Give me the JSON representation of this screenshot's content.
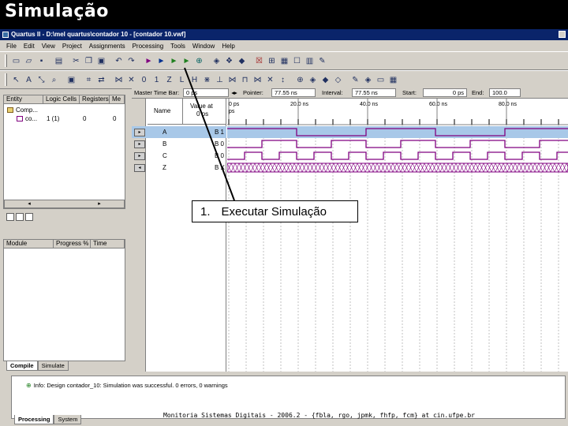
{
  "slide": {
    "title": "Simulação"
  },
  "window": {
    "title": "Quartus II - D:\\mel quartus\\contador 10 - [contador 10.vwf]"
  },
  "menu": [
    "File",
    "Edit",
    "View",
    "Project",
    "Assignments",
    "Processing",
    "Tools",
    "Window",
    "Help"
  ],
  "hierarchy": {
    "columns": [
      "Entity",
      "Logic Cells",
      "Registers",
      "Me"
    ],
    "rows": [
      {
        "entity": "Comp...",
        "cells": "",
        "regs": "",
        "mem": ""
      },
      {
        "entity": "co...",
        "cells": "1 (1)",
        "regs": "0",
        "mem": "0"
      }
    ]
  },
  "status_panel": {
    "columns": [
      "Module",
      "Progress %",
      "Time"
    ]
  },
  "left_tabs": [
    "Compile",
    "Simulate"
  ],
  "wave": {
    "master_label": "Master Time Bar:",
    "master_value": "0 ps",
    "pointer_label": "Pointer:",
    "pointer_value": "77.55 ns",
    "interval_label": "Interval:",
    "interval_value": "77.55 ns",
    "start_label": "Start:",
    "start_value": "0 ps",
    "end_label": "End:",
    "end_value": "100.0",
    "name_header": "Name",
    "value_header": "Value at",
    "value_header2": "0 ps",
    "time_marks": [
      "0 ps",
      "20.0 ns",
      "40.0 ns",
      "60.0 ns",
      "80.0 ns"
    ],
    "time_sub": "ps",
    "signals": [
      {
        "name": "A",
        "value": "B 1"
      },
      {
        "name": "B",
        "value": "B 0"
      },
      {
        "name": "C",
        "value": "B 0"
      },
      {
        "name": "Z",
        "value": "B X"
      }
    ]
  },
  "callout": {
    "number": "1.",
    "text": "Executar Simulação"
  },
  "messages": {
    "line": "Info: Design contador_10: Simulation was successful. 0 errors, 0 warnings"
  },
  "bottom_tabs": [
    "Processing",
    "System"
  ],
  "footer": "Monitoria Sistemas Digitais - 2006.2 - {fbla, rgo, jpmk, fhfp, fcm} at cin.ufpe.br",
  "colors": {
    "wave": "#800080",
    "selection": "#a8c8e8",
    "titlebar": "#0a246a"
  }
}
